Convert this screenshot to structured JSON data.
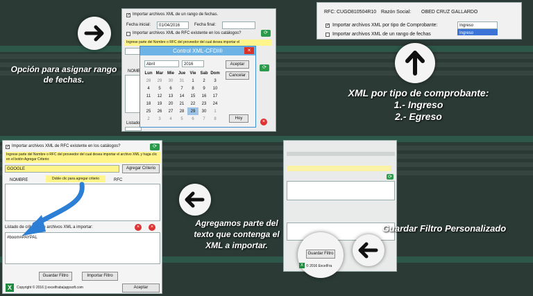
{
  "top_left": {
    "chk_range": "Importar archivos XML de un rango de fechas.",
    "fecha_inicial_label": "Fecha inicial:",
    "fecha_inicial_value": "01/04/2016",
    "fecha_final_label": "Fecha final:",
    "chk_rfc": "Importar archivos XML de RFC existente en los catálogos?",
    "hint": "Ingrese parte del Nombre o RFC del proveedor del cual desea importar el",
    "nombre_col": "NOMBRE",
    "listado": "Listado",
    "calendar": {
      "title": "Control XML-CFDI®",
      "month": "Abril",
      "year": "2016",
      "days": [
        "Lun",
        "Mar",
        "Mie",
        "Jue",
        "Vie",
        "Sab",
        "Dom"
      ],
      "weeks": [
        [
          "28",
          "29",
          "30",
          "31",
          "1",
          "2",
          "3"
        ],
        [
          "4",
          "5",
          "6",
          "7",
          "8",
          "9",
          "10"
        ],
        [
          "11",
          "12",
          "13",
          "14",
          "15",
          "16",
          "17"
        ],
        [
          "18",
          "19",
          "20",
          "21",
          "22",
          "23",
          "24"
        ],
        [
          "25",
          "26",
          "27",
          "28",
          "29",
          "30",
          "1"
        ],
        [
          "2",
          "3",
          "4",
          "5",
          "6",
          "7",
          "8"
        ]
      ],
      "accept": "Aceptar",
      "cancel": "Cancelar",
      "today": "Hoy"
    }
  },
  "captions": {
    "opcion": "Opción para asignar rango de fechas.",
    "xml_tipo_title": "XML por tipo de comprobante:",
    "xml_tipo_1": "1.-  Ingreso",
    "xml_tipo_2": "2.- Egreso",
    "agregamos": "Agregamos parte del texto que contenga el XML a importar.",
    "guardar": "Guardar Filtro Personalizado"
  },
  "top_right": {
    "rfc_label": "RFC:",
    "rfc_value": "CUGO810504R10",
    "razon_label": "Razón Social:",
    "razon_value": "OBED CRUZ GALLARDO",
    "chk_tipo": "Importar archivos XML por tipo de Comprobante:",
    "tipo_value": "Ingreso",
    "tipo_option": "Ingreso",
    "chk_rango": "Importar archivos XML de un rango de fechas"
  },
  "bottom_left": {
    "chk_rfc": "Importar archivos XML de RFC existente en los catálogos?",
    "hint": "Ingrese parte del Nombre o RFC del proveedor del cual desea importar el archivo XML y haga clic en el botón Agregar Criterio:",
    "criterio_value": "GOOGLE",
    "agregar_btn": "Agregar Criterio",
    "nombre_col": "NOMBRE",
    "rfc_col": "RFC",
    "dbl_click_hint": "Doble clic para agregar criterio",
    "listado": "Listado de criterios de archivos XML a importar:",
    "listado_item": "#boom#PAYPAL",
    "guardar_btn": "Guardar Filtro",
    "importar_btn": "Importar Filtro",
    "copyright": "Copyright © 2016 || excelfraba|appsoft.com",
    "aceptar_btn": "Aceptar"
  },
  "bottom_right": {
    "guardar_btn": "Guardar Filtro",
    "copyright": "© 2016 ExcelFra"
  }
}
